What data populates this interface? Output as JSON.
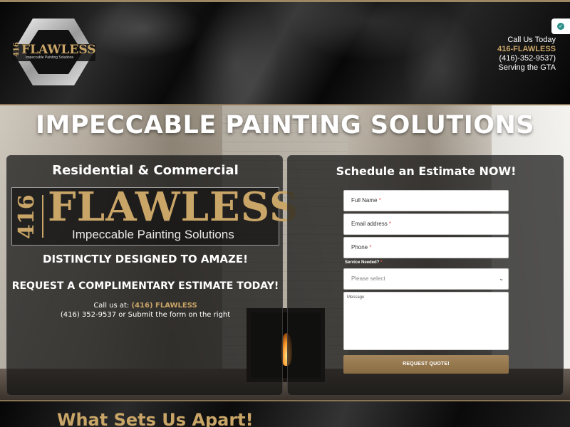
{
  "header": {
    "logo_num": "416",
    "logo_word": "FLAWLESS",
    "logo_tagline": "Impeccable Painting Solutions",
    "contact": {
      "line1": "Call Us Today",
      "line2": "416-FLAWLESS",
      "line3": "(416)-352-9537)",
      "line4": "Serving the GTA"
    }
  },
  "hero": {
    "title": "IMPECCABLE PAINTING SOLUTIONS"
  },
  "left_panel": {
    "subhead": "Residential & Commercial",
    "logo_num": "416",
    "logo_word": "FLAWLESS",
    "logo_tagline": "Impeccable Painting Solutions",
    "tagline1": "DISTINCTLY DESIGNED TO AMAZE!",
    "tagline2": "REQUEST A COMPLIMENTARY ESTIMATE TODAY!",
    "call_prefix": "Call us at:",
    "call_brand": "(416) FLAWLESS",
    "call_line2": "(416) 352-9537 or Submit the form on the right"
  },
  "form": {
    "title": "Schedule an Estimate NOW!",
    "full_name_placeholder": "Full Name",
    "email_placeholder": "Email address",
    "phone_placeholder": "Phone",
    "required_mark": "*",
    "service_label": "Service Needed?",
    "service_selected": "Please select",
    "message_placeholder": "Message",
    "submit_label": "REQUEST QUOTE!"
  },
  "bottom": {
    "heading": "What Sets Us Apart!"
  },
  "colors": {
    "gold": "#c9a567",
    "button": "#a4855b",
    "required": "#e5533f",
    "badge": "#2d8f8a"
  }
}
